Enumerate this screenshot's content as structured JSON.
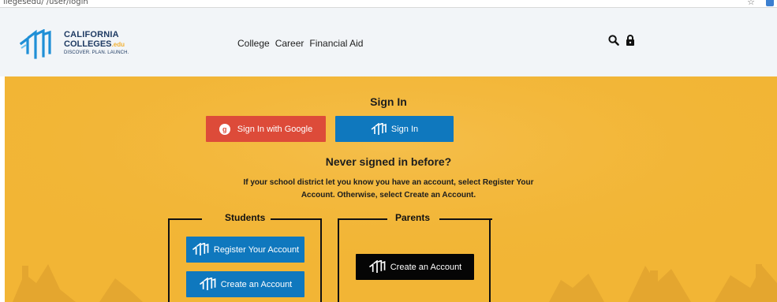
{
  "browser": {
    "url_fragment": "llegesedu/ /user/login"
  },
  "brand": {
    "name_line1": "CALIFORNIA",
    "name_line2": "COLLEGES",
    "name_suffix": ".edu",
    "tagline": "DISCOVER. PLAN. LAUNCH.",
    "navy": "#1f3b63",
    "accent": "#f2b134"
  },
  "nav": {
    "items": [
      "College",
      "Career",
      "Financial Aid"
    ]
  },
  "header_icons": [
    "search-icon",
    "lock-icon"
  ],
  "signin": {
    "title": "Sign In",
    "google_label": "Sign In with Google",
    "google_badge": "g",
    "signin_label": "Sign In",
    "google_color": "#dd4b39",
    "primary_color": "#0f78be"
  },
  "registration": {
    "title": "Never signed in before?",
    "info_line1": "If your school district let you know you have an account, select Register Your",
    "info_line2": "Account. Otherwise, select Create an Account."
  },
  "students": {
    "label": "Students",
    "register_label": "Register Your Account",
    "create_label": "Create an Account"
  },
  "parents": {
    "label": "Parents",
    "create_label": "Create an Account"
  },
  "hero_color": "#f2b535"
}
